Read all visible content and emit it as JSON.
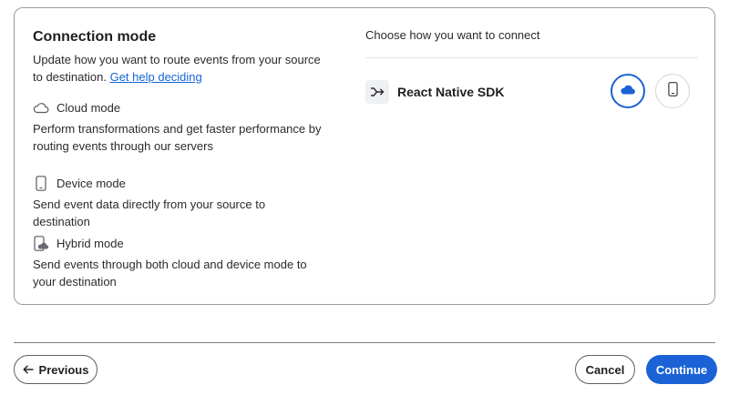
{
  "connection": {
    "title": "Connection mode",
    "description": "Update how you want to route events from your source to destination.",
    "help_link": "Get help deciding"
  },
  "modes": [
    {
      "name": "Cloud mode",
      "icon": "cloud-outline-icon",
      "description": "Perform transformations and get faster performance by routing events through our servers"
    },
    {
      "name": "Device mode",
      "icon": "phone-outline-icon",
      "description": "Send event data directly from your source to destination"
    },
    {
      "name": "Hybrid mode",
      "icon": "hybrid-icon",
      "description": "Send events through both cloud and device mode to your destination"
    }
  ],
  "right_panel": {
    "heading": "Choose how you want to connect",
    "source": {
      "name": "React Native SDK",
      "icon": "merge-arrow-icon"
    },
    "selected_mode": "Cloud mode"
  },
  "footer": {
    "previous_label": "Previous",
    "cancel_label": "Cancel",
    "continue_label": "Continue"
  },
  "colors": {
    "accent": "#1b62d6",
    "link": "#1665d8",
    "border": "#9a9aa3"
  }
}
